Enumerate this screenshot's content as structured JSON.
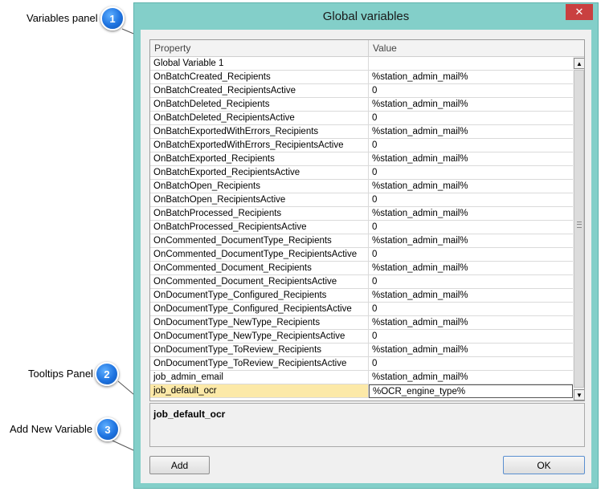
{
  "window": {
    "title": "Global variables",
    "close_glyph": "✕"
  },
  "callouts": [
    {
      "number": "1",
      "label": "Variables panel"
    },
    {
      "number": "2",
      "label": "Tooltips Panel"
    },
    {
      "number": "3",
      "label": "Add New Variable"
    }
  ],
  "grid": {
    "columns": {
      "property": "Property",
      "value": "Value"
    },
    "selected_row": 24,
    "rows": [
      {
        "property": "Global Variable 1",
        "value": ""
      },
      {
        "property": "OnBatchCreated_Recipients",
        "value": "%station_admin_mail%"
      },
      {
        "property": "OnBatchCreated_RecipientsActive",
        "value": "0"
      },
      {
        "property": "OnBatchDeleted_Recipients",
        "value": "%station_admin_mail%"
      },
      {
        "property": "OnBatchDeleted_RecipientsActive",
        "value": "0"
      },
      {
        "property": "OnBatchExportedWithErrors_Recipients",
        "value": "%station_admin_mail%"
      },
      {
        "property": "OnBatchExportedWithErrors_RecipientsActive",
        "value": "0"
      },
      {
        "property": "OnBatchExported_Recipients",
        "value": "%station_admin_mail%"
      },
      {
        "property": "OnBatchExported_RecipientsActive",
        "value": "0"
      },
      {
        "property": "OnBatchOpen_Recipients",
        "value": "%station_admin_mail%"
      },
      {
        "property": "OnBatchOpen_RecipientsActive",
        "value": "0"
      },
      {
        "property": "OnBatchProcessed_Recipients",
        "value": "%station_admin_mail%"
      },
      {
        "property": "OnBatchProcessed_RecipientsActive",
        "value": "0"
      },
      {
        "property": "OnCommented_DocumentType_Recipients",
        "value": "%station_admin_mail%"
      },
      {
        "property": "OnCommented_DocumentType_RecipientsActive",
        "value": "0"
      },
      {
        "property": "OnCommented_Document_Recipients",
        "value": "%station_admin_mail%"
      },
      {
        "property": "OnCommented_Document_RecipientsActive",
        "value": "0"
      },
      {
        "property": "OnDocumentType_Configured_Recipients",
        "value": "%station_admin_mail%"
      },
      {
        "property": "OnDocumentType_Configured_RecipientsActive",
        "value": "0"
      },
      {
        "property": "OnDocumentType_NewType_Recipients",
        "value": "%station_admin_mail%"
      },
      {
        "property": "OnDocumentType_NewType_RecipientsActive",
        "value": "0"
      },
      {
        "property": "OnDocumentType_ToReview_Recipients",
        "value": "%station_admin_mail%"
      },
      {
        "property": "OnDocumentType_ToReview_RecipientsActive",
        "value": "0"
      },
      {
        "property": "job_admin_email",
        "value": "%station_admin_mail%"
      },
      {
        "property": "job_default_ocr",
        "value": "%OCR_engine_type%"
      }
    ]
  },
  "scrollbar": {
    "up_glyph": "▲",
    "down_glyph": "▼"
  },
  "tooltip": {
    "title": "job_default_ocr"
  },
  "buttons": {
    "add": "Add",
    "ok": "OK"
  }
}
